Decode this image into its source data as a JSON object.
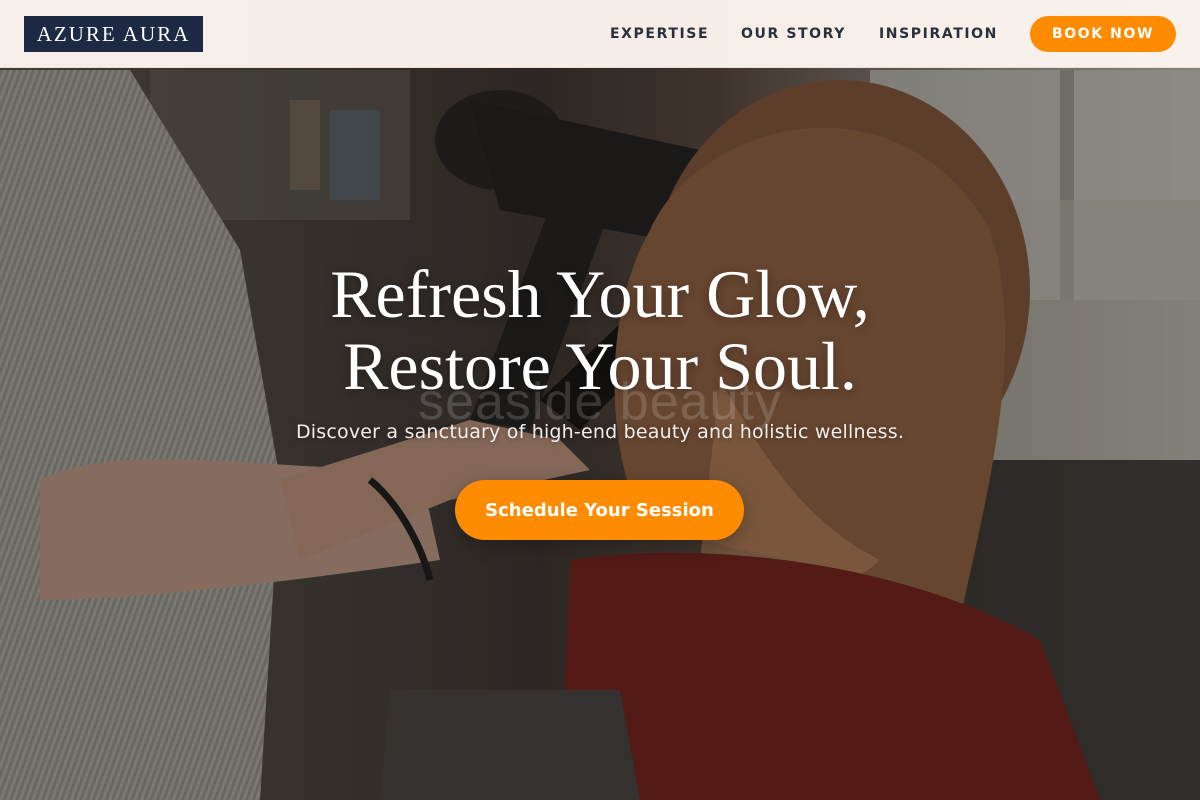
{
  "brand": {
    "logo_text": "AZURE AURA"
  },
  "nav": {
    "links": [
      {
        "label": "EXPERTISE"
      },
      {
        "label": "OUR STORY"
      },
      {
        "label": "INSPIRATION"
      }
    ],
    "cta_label": "BOOK NOW"
  },
  "hero": {
    "headline_line1": "Refresh Your Glow,",
    "headline_line2": "Restore Your Soul.",
    "subtitle": "Discover a sanctuary of high-end beauty and holistic wellness.",
    "cta_label": "Schedule Your Session",
    "watermark_text": "seaside beauty",
    "image_alt": "stylist-blow-drying-client-hair-photo"
  },
  "colors": {
    "accent": "#ff8c00",
    "logo_bg": "#1e2a44",
    "nav_bg": "#fdf6f0",
    "nav_text": "#2b2f3a"
  },
  "icons": {}
}
